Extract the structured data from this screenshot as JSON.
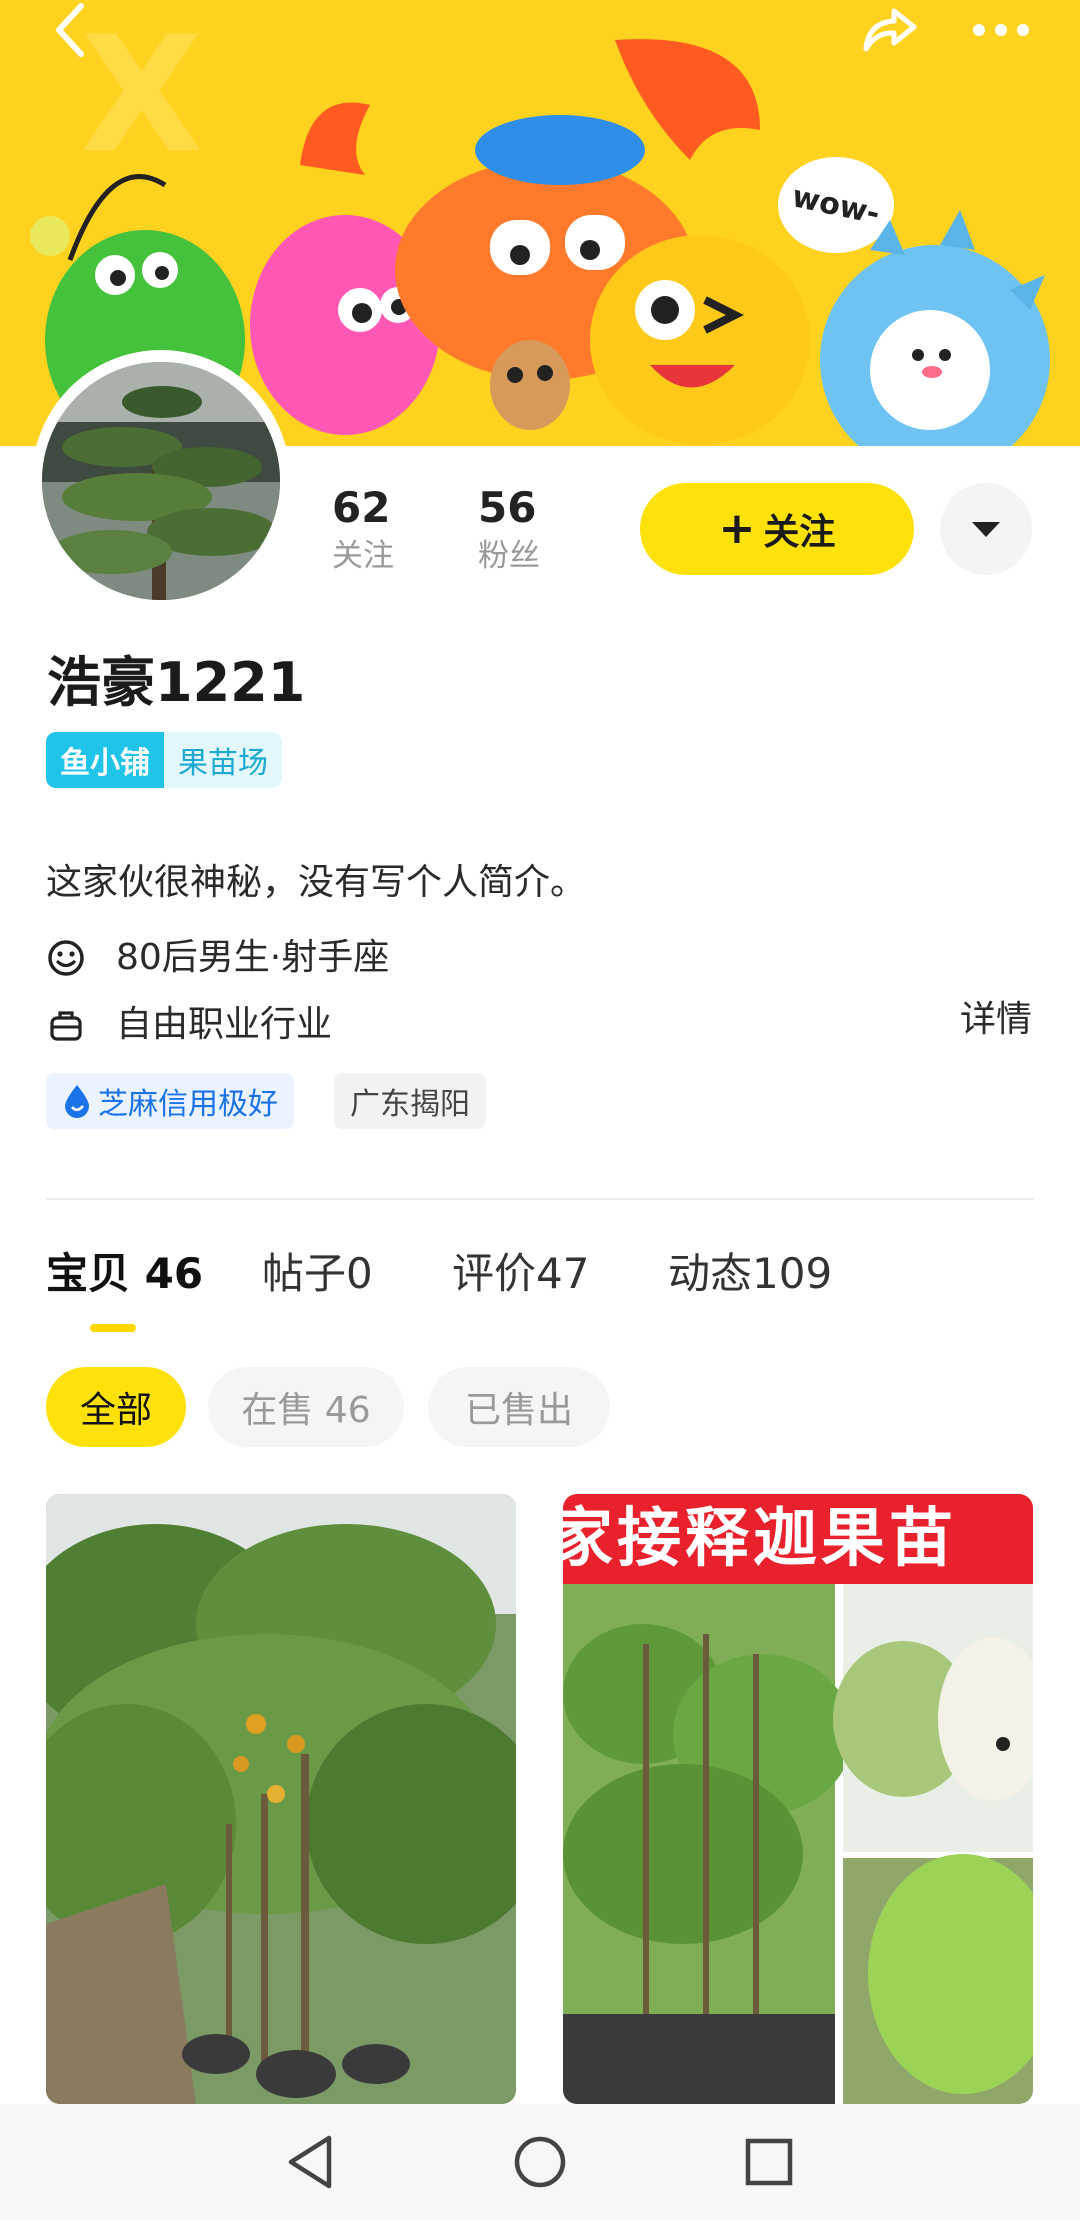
{
  "header": {
    "back_icon": "back-arrow-icon",
    "share_icon": "share-icon",
    "more_icon": "more-dots-icon",
    "banner_badge": "wow-"
  },
  "profile": {
    "following_count": "62",
    "following_label": "关注",
    "followers_count": "56",
    "followers_label": "粉丝",
    "follow_button_plus": "+",
    "follow_button_label": "关注",
    "dropdown_icon": "caret-down-icon",
    "username": "浩豪1221",
    "shop_tag_prefix": "鱼小铺",
    "shop_tag_name": "果苗场",
    "bio": "这家伙很神秘，没有写个人简介。",
    "demographic": "80后男生·射手座",
    "occupation": "自由职业行业",
    "detail_link": "详情",
    "credit_badge": "芝麻信用极好",
    "location": "广东揭阳"
  },
  "tabs": [
    {
      "label": "宝贝",
      "count": "46",
      "active": true
    },
    {
      "label": "帖子",
      "count": "0",
      "active": false
    },
    {
      "label": "评价",
      "count": "47",
      "active": false
    },
    {
      "label": "动态",
      "count": "109",
      "active": false
    }
  ],
  "filters": [
    {
      "label": "全部",
      "active": true
    },
    {
      "label": "在售 46",
      "active": false
    },
    {
      "label": "已售出",
      "active": false
    }
  ],
  "products": [
    {
      "image": "fruit-tree-nursery-photo"
    },
    {
      "image": "custard-apple-seedling-photo",
      "image_text": "家接释迦果苗"
    }
  ],
  "colors": {
    "accent_yellow": "#ffe10a",
    "shop_tag_blue": "#20c4e8",
    "credit_blue": "#1a73e8"
  },
  "navbar": {
    "back_icon": "nav-back-icon",
    "home_icon": "nav-home-icon",
    "recents_icon": "nav-recents-icon"
  }
}
